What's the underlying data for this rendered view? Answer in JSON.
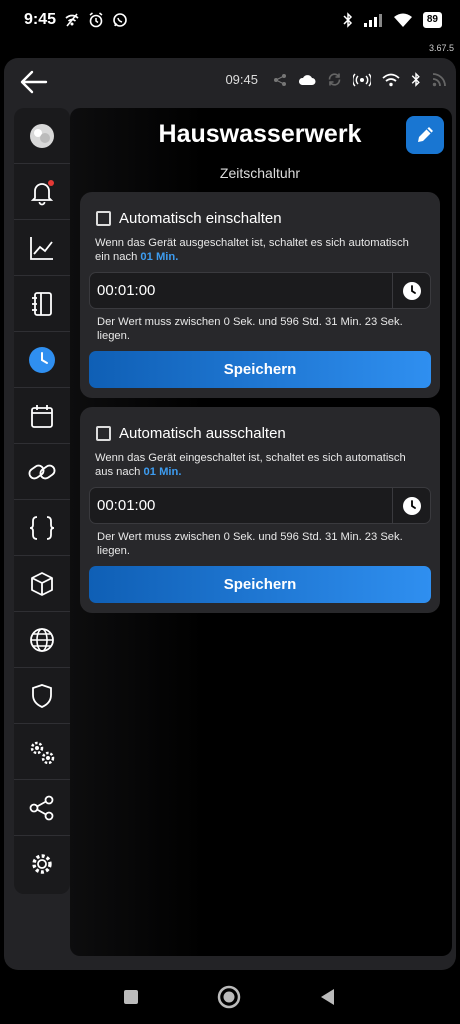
{
  "status_bar": {
    "time": "9:45",
    "battery": "89"
  },
  "version": "3.67.5",
  "top_bar": {
    "time": "09:45"
  },
  "page": {
    "title": "Hauswasserwerk",
    "subtitle": "Zeitschaltuhr"
  },
  "cards": [
    {
      "checkbox_label": "Automatisch einschalten",
      "checked": false,
      "desc_text": "Wenn das Gerät ausgeschaltet ist, schaltet es sich automatisch ein nach",
      "desc_highlight": "01 Min.",
      "time_value": "00:01:00",
      "hint": "Der Wert muss zwischen 0 Sek. und 596 Std. 31 Min. 23 Sek. liegen.",
      "save_label": "Speichern"
    },
    {
      "checkbox_label": "Automatisch ausschalten",
      "checked": false,
      "desc_text": "Wenn das Gerät eingeschaltet ist, schaltet es sich automatisch aus nach",
      "desc_highlight": "01 Min.",
      "time_value": "00:01:00",
      "hint": "Der Wert muss zwischen 0 Sek. und 596 Std. 31 Min. 23 Sek. liegen.",
      "save_label": "Speichern"
    }
  ],
  "sidebar": {
    "items": [
      {
        "icon": "device-avatar-icon",
        "active": false
      },
      {
        "icon": "bell-icon",
        "active": false,
        "badge": true
      },
      {
        "icon": "chart-icon",
        "active": false
      },
      {
        "icon": "notebook-icon",
        "active": false
      },
      {
        "icon": "clock-icon",
        "active": true
      },
      {
        "icon": "calendar-icon",
        "active": false
      },
      {
        "icon": "link-icon",
        "active": false
      },
      {
        "icon": "braces-icon",
        "active": false
      },
      {
        "icon": "cube-icon",
        "active": false
      },
      {
        "icon": "globe-icon",
        "active": false
      },
      {
        "icon": "shield-icon",
        "active": false
      },
      {
        "icon": "gears-icon",
        "active": false
      },
      {
        "icon": "share-icon",
        "active": false
      },
      {
        "icon": "settings-icon",
        "active": false
      }
    ]
  },
  "colors": {
    "accent": "#2f8ff0",
    "badge": "#e53935",
    "background": "#000000",
    "panel": "#232326"
  }
}
